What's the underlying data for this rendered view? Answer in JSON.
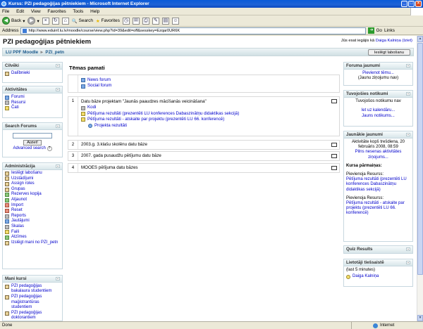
{
  "window": {
    "title": "Kurss: PZI pedagoģijas pētniekiem - Microsoft Internet Explorer"
  },
  "menu": [
    "File",
    "Edit",
    "View",
    "Favorites",
    "Tools",
    "Help"
  ],
  "toolbar": {
    "back": "Back",
    "search": "Search",
    "favorites": "Favorites"
  },
  "address": {
    "label": "Address",
    "url": "http://www.eduinf.lu.lv/moodle/course/view.php?id=39&edit=off&sesskey=Ezqar0UR6K",
    "go": "Go",
    "links": "Links"
  },
  "page": {
    "course_title": "PZI pedagoģijas pētniekiem",
    "login_prefix": "Jūs esat iegājis kā",
    "login_user": "Daiga Kalniņa",
    "logout_link": "(Iziet)",
    "breadcrumb": [
      "LU PPF Moodle",
      "PZI_petn"
    ],
    "edit_button": "Ieslēgt labošanu"
  },
  "left": {
    "people": {
      "title": "Cilvēki",
      "items": [
        "Dalībnieki"
      ]
    },
    "activities": {
      "title": "Aktivitātes",
      "items": [
        "Forumi",
        "Resursi",
        "Čati"
      ]
    },
    "search": {
      "title": "Search Forums",
      "button": "Aiziet!",
      "advanced": "Advanced search",
      "help": "?"
    },
    "admin": {
      "title": "Administrācija",
      "items": [
        "Ieslēgt labošanu",
        "Uzstādījumi",
        "Assign roles",
        "Grupas",
        "Rezerves kopija",
        "Atjaunot",
        "Import",
        "Reset",
        "Reports",
        "Jautājumi",
        "Skalas",
        "Faili",
        "Atzīmes",
        "Izslēgt mani no PZI_petn"
      ]
    },
    "courses": {
      "title": "Mani kursi",
      "items": [
        "PZI pedagoģijas bakalaura studentiem",
        "PZI pedagoģijas maģistrantūras studentiem",
        "PZI pedagoģijas doktorantiem"
      ]
    }
  },
  "main": {
    "section_title": "Tēmas pamati",
    "section0": [
      "News forum",
      "Social forum"
    ],
    "topics": [
      {
        "num": "1",
        "title": "Datu bāze projektam \"Jaunās paaudzes mācīšanās veicināšana\"",
        "items": [
          "Kodi",
          "Pētījuma rezultāti (prezentēti LU konferences Dabaszinātņu didaktikas sekcijā)",
          "Pētījuma rezultāti - atskaite par projektu (prezentēti LU 66. konferencē)"
        ],
        "sub": "Projekta rezultāti"
      },
      {
        "num": "2",
        "title": "2003.g. 3.klašu skolēnu datu bāze"
      },
      {
        "num": "3",
        "title": "2007. gada pusaudžu pētījumu datu bāze"
      },
      {
        "num": "4",
        "title": "MOOES pētījuma datu bāzes"
      }
    ]
  },
  "right": {
    "forum_news": {
      "title": "Foruma jaunumi",
      "link": "Pievienot tēmu...",
      "note": "(Jaunu ziņojumu nav)"
    },
    "events": {
      "title": "Tuvojošies notikumi",
      "note": "Tuvojošos notikumu nav",
      "link1": "Iet uz kalendāru...",
      "link2": "Jauns notikums..."
    },
    "recent": {
      "title": "Jaunākie jaunumi",
      "since": "Aktivitāte kopš trešdiena, 20 februāris 2008, 08:59",
      "full_report": "Pilns nesenas aktivitātes ziņojums...",
      "changes_title": "Kursa pārmaiņas:",
      "added1": "Pievienoja Resurss:",
      "link1": "Pētījuma rezultāti (prezentēti LU konferences Dabaszinātņu didaktikas sekcijā)",
      "added2": "Pievienoja Resurss:",
      "link2": "Pētījuma rezultāti - atskaite par projektu (prezentēti LU 66. konferencē)"
    },
    "quiz": {
      "title": "Quiz Results"
    },
    "online": {
      "title": "Lietotāji tiešsaistē",
      "note": "(last 5 minutes)",
      "user": "Daiga Kalniņa"
    }
  },
  "status": {
    "left": "Done",
    "zone": "Internet"
  }
}
